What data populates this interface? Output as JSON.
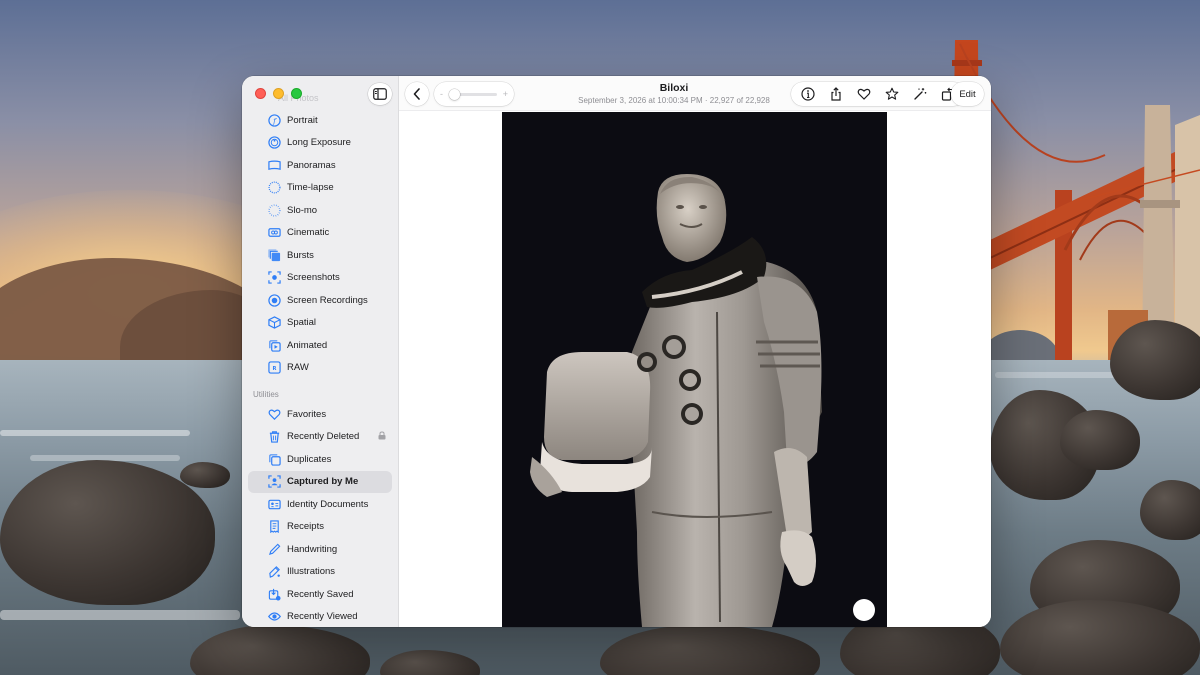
{
  "sidebar": {
    "faded_title": "All Photos",
    "media_types": [
      {
        "label": "Portrait",
        "icon": "portrait-icon"
      },
      {
        "label": "Long Exposure",
        "icon": "long-exposure-icon"
      },
      {
        "label": "Panoramas",
        "icon": "panorama-icon"
      },
      {
        "label": "Time-lapse",
        "icon": "timelapse-icon"
      },
      {
        "label": "Slo-mo",
        "icon": "slomo-icon"
      },
      {
        "label": "Cinematic",
        "icon": "cinematic-icon"
      },
      {
        "label": "Bursts",
        "icon": "bursts-icon"
      },
      {
        "label": "Screenshots",
        "icon": "screenshot-icon"
      },
      {
        "label": "Screen Recordings",
        "icon": "screen-recording-icon"
      },
      {
        "label": "Spatial",
        "icon": "spatial-icon"
      },
      {
        "label": "Animated",
        "icon": "animated-icon"
      },
      {
        "label": "RAW",
        "icon": "raw-icon"
      }
    ],
    "utilities_heading": "Utilities",
    "utilities": [
      {
        "label": "Favorites",
        "icon": "heart-icon"
      },
      {
        "label": "Recently Deleted",
        "icon": "trash-icon"
      },
      {
        "label": "Duplicates",
        "icon": "duplicates-icon"
      },
      {
        "label": "Captured by Me",
        "icon": "captured-icon"
      },
      {
        "label": "Identity Documents",
        "icon": "id-card-icon"
      },
      {
        "label": "Receipts",
        "icon": "receipt-icon"
      },
      {
        "label": "Handwriting",
        "icon": "pen-icon"
      },
      {
        "label": "Illustrations",
        "icon": "illustration-icon"
      },
      {
        "label": "Recently Saved",
        "icon": "recently-saved-icon"
      },
      {
        "label": "Recently Viewed",
        "icon": "eye-icon"
      }
    ],
    "active": "Captured by Me"
  },
  "toolbar": {
    "zoom_minus": "-",
    "zoom_plus": "+",
    "title": "Biloxi",
    "subtitle": "September 3, 2026 at 10:00:34 PM  ·  22,927 of 22,928",
    "edit_label": "Edit"
  },
  "colors": {
    "accent": "#2f7ef6",
    "selection": "#dcdce0"
  }
}
